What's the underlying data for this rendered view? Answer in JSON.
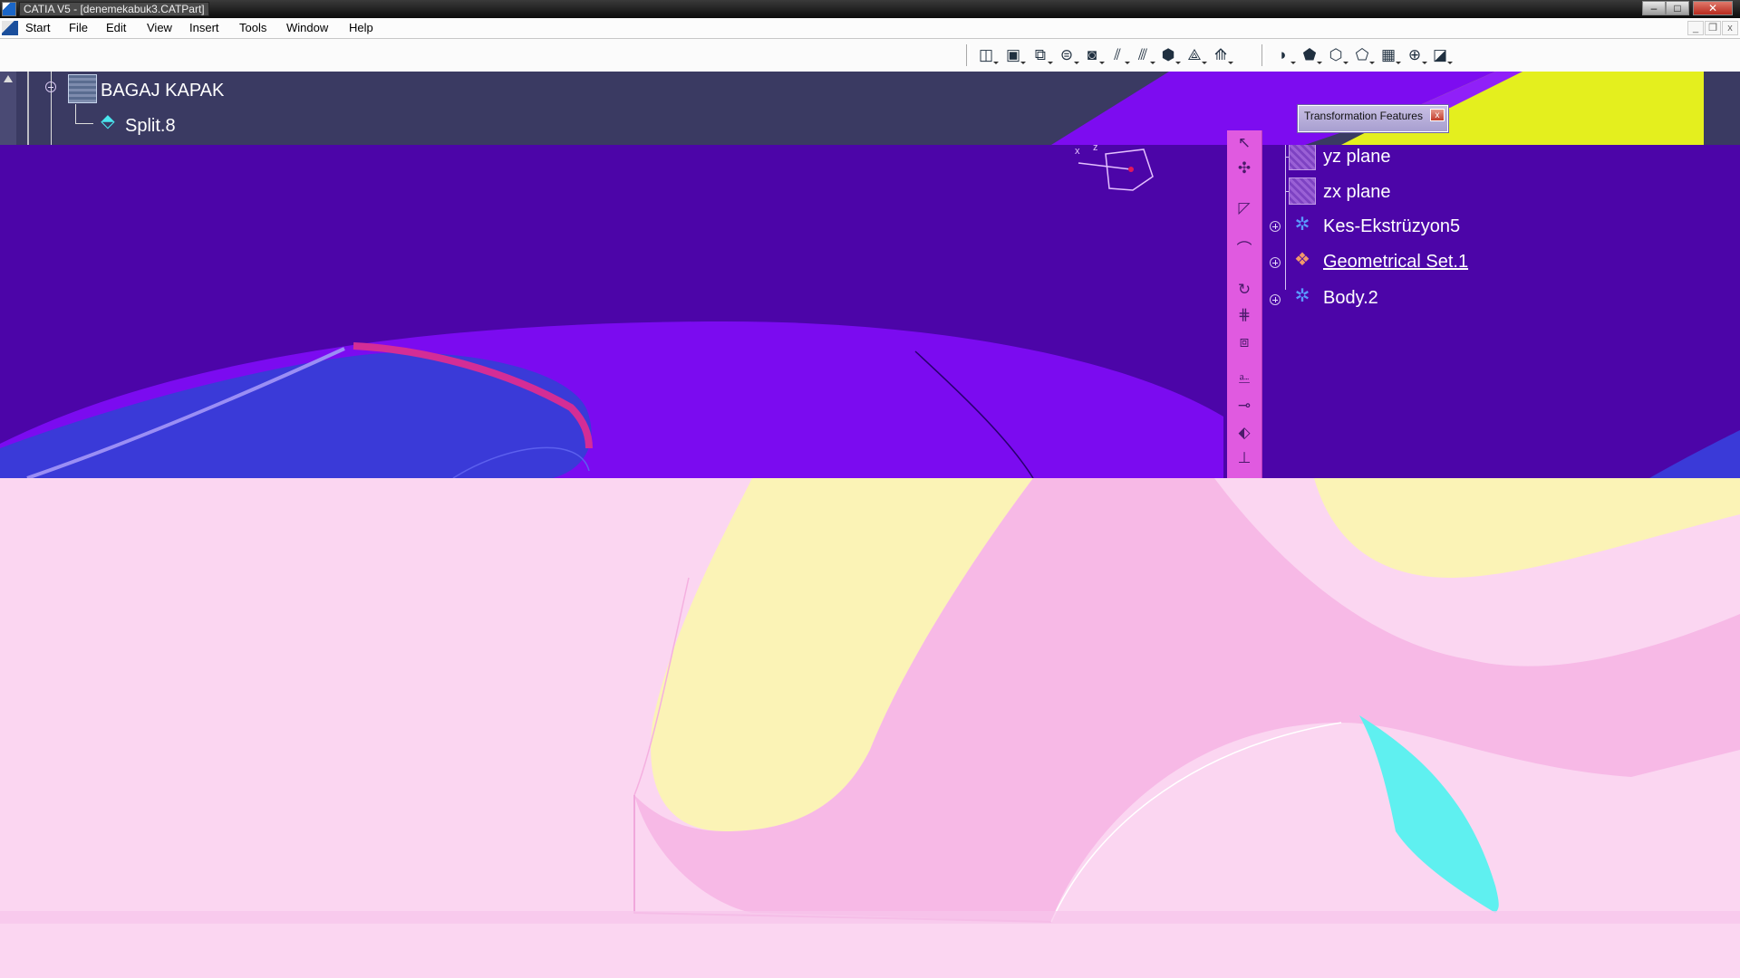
{
  "window": {
    "title": "CATIA V5 - [denemekabuk3.CATPart]",
    "minimize": "–",
    "maximize": "□",
    "close": "✕"
  },
  "menu": {
    "items": [
      "Start",
      "File",
      "Edit",
      "View",
      "Insert",
      "Tools",
      "Window",
      "Help"
    ]
  },
  "mdi": {
    "minimize": "_",
    "restore": "❐",
    "close": "x"
  },
  "tree_top": {
    "root_label": "BAGAJ KAPAK",
    "child_label": "Split.8"
  },
  "dialog": {
    "title": "Transformation Features",
    "close": "x"
  },
  "tree_right": [
    {
      "label": "yz plane",
      "icon": "plane-icon"
    },
    {
      "label": "zx plane",
      "icon": "plane-icon"
    },
    {
      "label": "Kes-Ekstrüzyon5",
      "icon": "part-body-icon"
    },
    {
      "label": "Geometrical Set.1",
      "icon": "geometrical-set-icon"
    },
    {
      "label": "Body.2",
      "icon": "body-icon"
    }
  ],
  "axis_labels": {
    "x": "x",
    "z": "z"
  },
  "colors": {
    "viewport_purple": "#4c05a8",
    "surface_yellow": "#e4ef1e",
    "bottom_pink": "#fbd6f1",
    "toolbar_magenta": "#e05ae0"
  }
}
